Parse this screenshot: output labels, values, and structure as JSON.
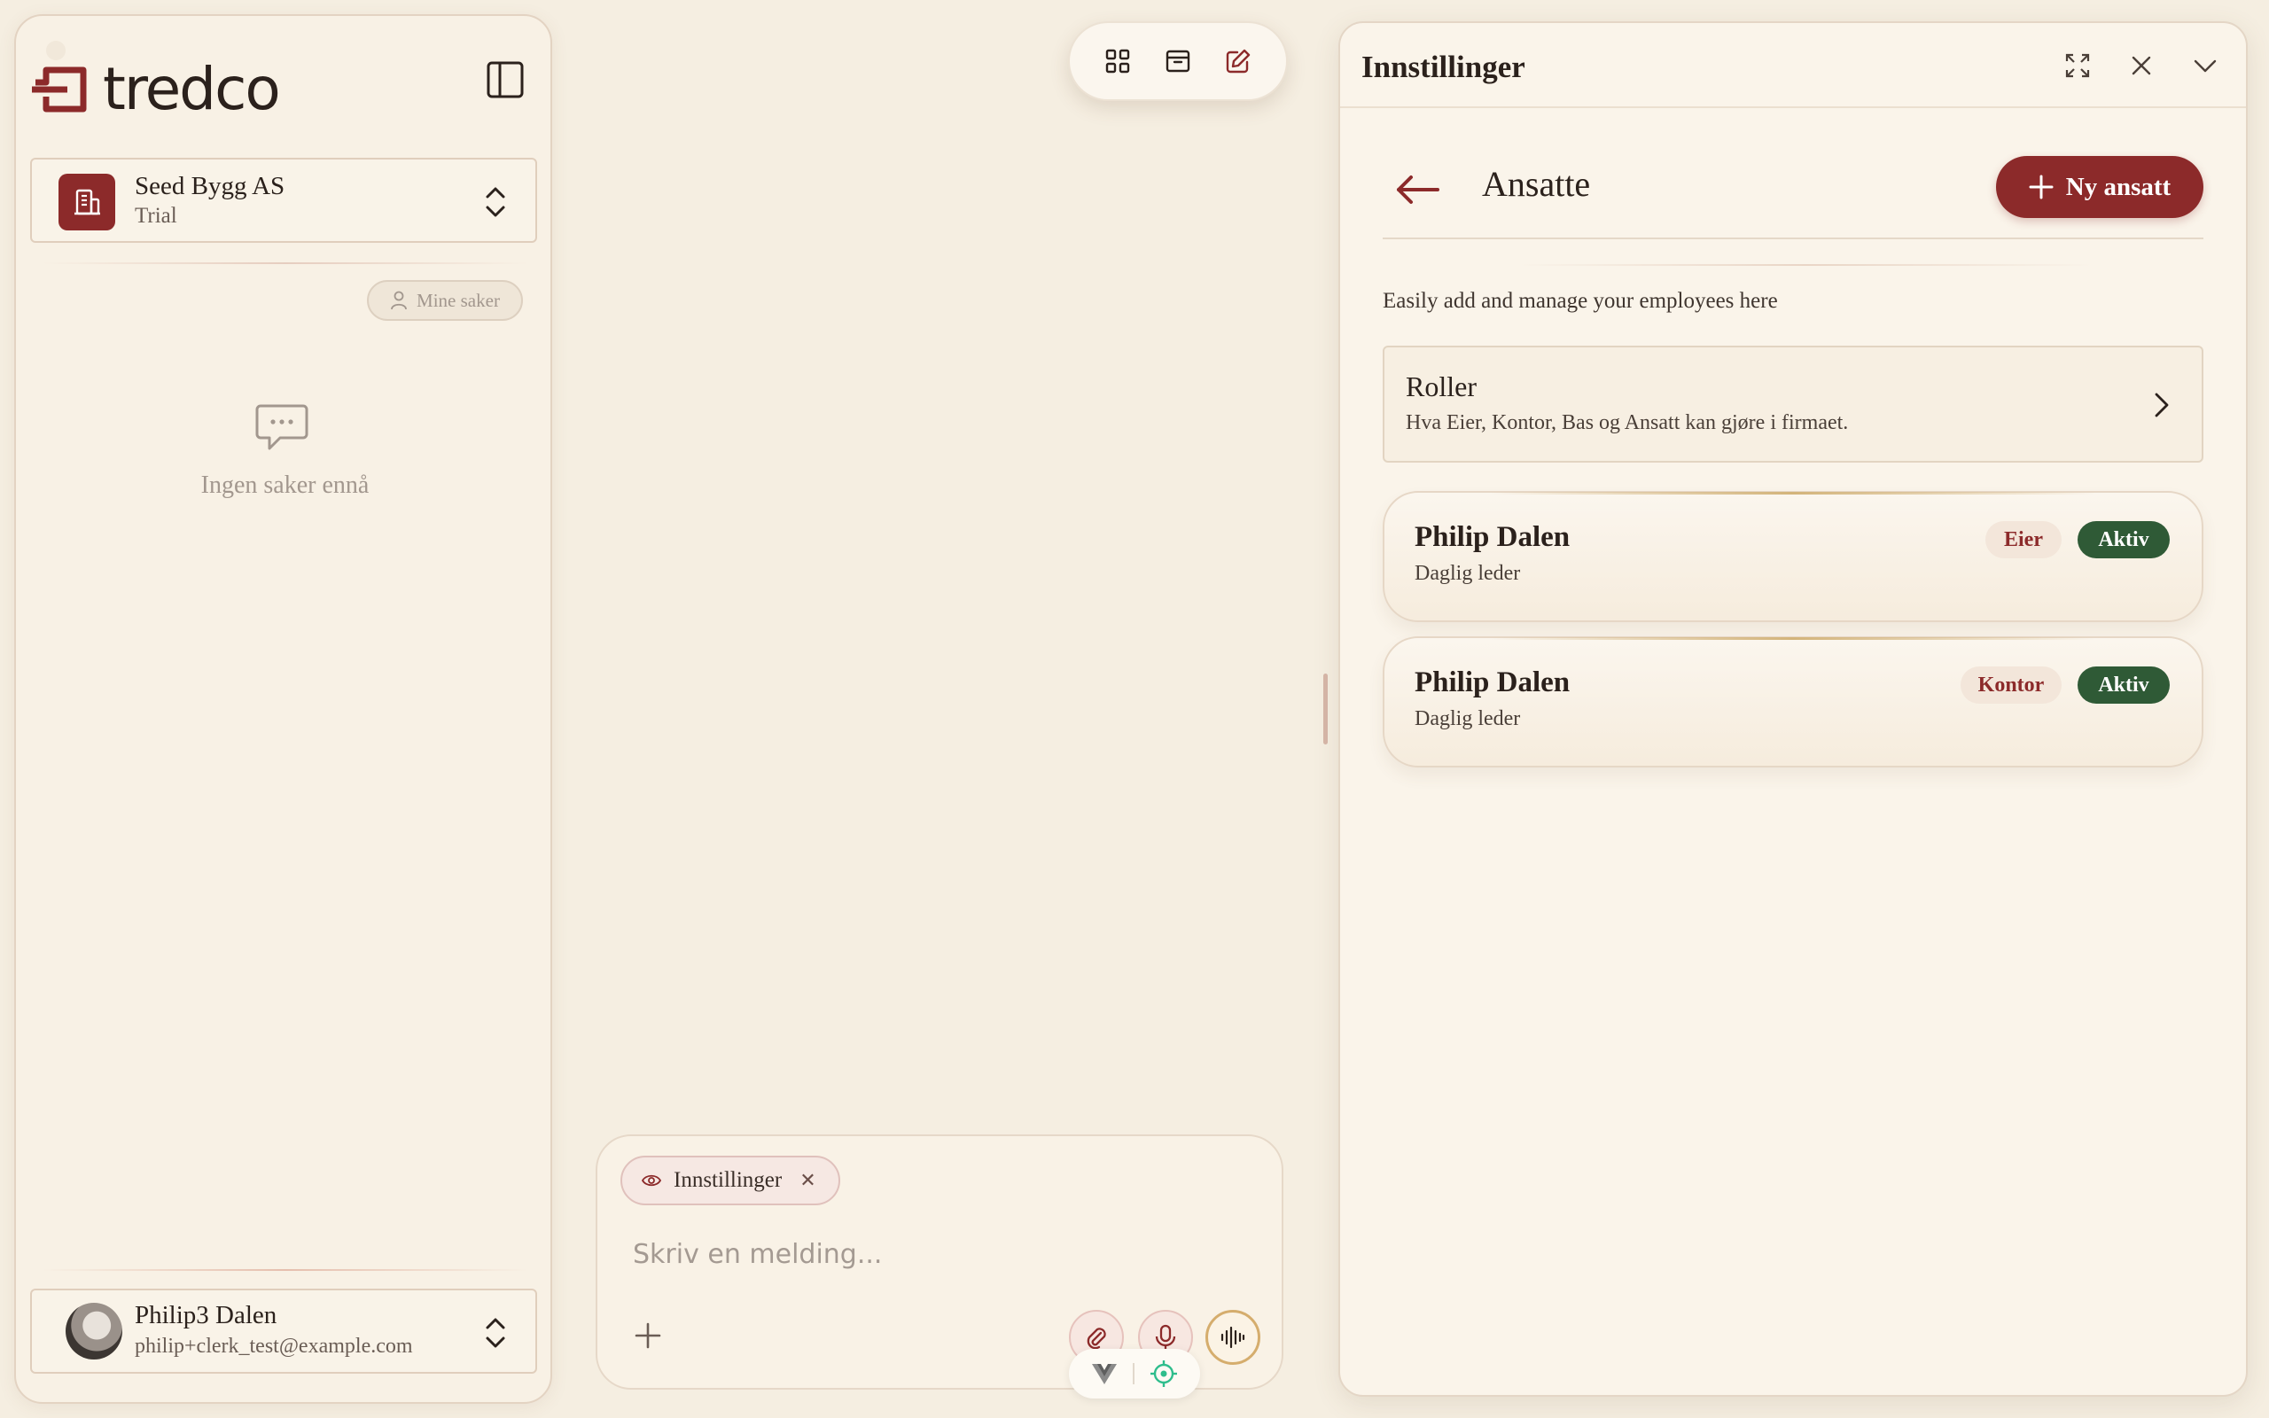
{
  "sidebar": {
    "brand": "tredco",
    "company": {
      "name": "Seed Bygg AS",
      "plan": "Trial"
    },
    "filter_chip": "Mine saker",
    "empty_state": "Ingen saker ennå",
    "user": {
      "name": "Philip3 Dalen",
      "email": "philip+clerk_test@example.com"
    }
  },
  "composer": {
    "context_chip": "Innstillinger",
    "placeholder": "Skriv en melding..."
  },
  "settings": {
    "panel_title": "Innstillinger",
    "section_title": "Ansatte",
    "new_button": "Ny ansatt",
    "intro": "Easily add and manage your employees here",
    "roles": {
      "title": "Roller",
      "description": "Hva Eier, Kontor, Bas og Ansatt kan gjøre i firmaet."
    },
    "employees": [
      {
        "name": "Philip Dalen",
        "title": "Daglig leder",
        "role": "Eier",
        "status": "Aktiv"
      },
      {
        "name": "Philip Dalen",
        "title": "Daglig leder",
        "role": "Kontor",
        "status": "Aktiv"
      }
    ]
  },
  "colors": {
    "brand": "#8c2a2a",
    "background": "#f5eee1",
    "status_active": "#2f5a36"
  },
  "icons": [
    "tredco-logo-icon",
    "sidebar-toggle-icon",
    "building-icon",
    "chevron-updown-icon",
    "user-icon",
    "chat-bubble-icon",
    "grid-icon",
    "inbox-icon",
    "edit-icon",
    "eye-icon",
    "close-icon",
    "plus-icon",
    "paperclip-icon",
    "microphone-icon",
    "waveform-icon",
    "vue-icon",
    "target-icon",
    "expand-icon",
    "chevron-down-icon",
    "arrow-left-icon",
    "chevron-right-icon"
  ]
}
